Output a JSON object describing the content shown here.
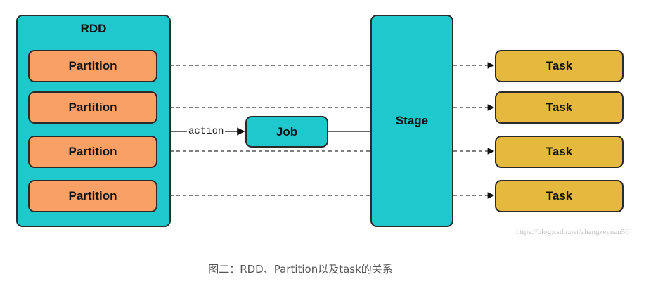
{
  "diagram": {
    "rdd_label": "RDD",
    "partitions": [
      "Partition",
      "Partition",
      "Partition",
      "Partition"
    ],
    "action_label": "action",
    "job_label": "Job",
    "stage_label": "Stage",
    "tasks": [
      "Task",
      "Task",
      "Task",
      "Task"
    ]
  },
  "colors": {
    "rdd": "#1fc8cc",
    "partition": "#f9a066",
    "job": "#1fc8cc",
    "stage": "#1fc8cc",
    "task": "#e4b93e"
  },
  "watermark": "https://blog.csdn.net/zhangzeyuan56",
  "caption": "图二：RDD、Partition以及task的关系"
}
